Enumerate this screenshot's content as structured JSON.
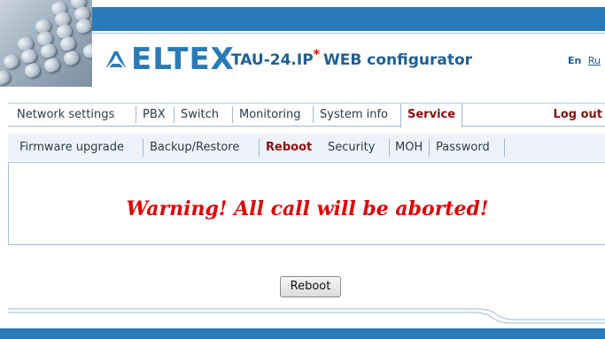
{
  "header": {
    "brand": "ELTEX",
    "product": "TAU-24.IP",
    "product_mark": "*",
    "product_suffix": "WEB configurator",
    "lang_current": "En",
    "lang_other": "Ru"
  },
  "menu": {
    "items": [
      "Network settings",
      "PBX",
      "Switch",
      "Monitoring",
      "System info",
      "Service"
    ],
    "active": "Service",
    "logout": "Log out"
  },
  "submenu": {
    "items": [
      "Firmware upgrade",
      "Backup/Restore",
      "Reboot",
      "Security",
      "MOH",
      "Password"
    ],
    "active": "Reboot"
  },
  "content": {
    "warning": "Warning! All call will be aborted!",
    "reboot_button": "Reboot"
  },
  "colors": {
    "header_blue": "#2a7ab8",
    "active_text": "#8b1010",
    "warning_red": "#e00000",
    "submenu_bg": "#eef3f9"
  }
}
